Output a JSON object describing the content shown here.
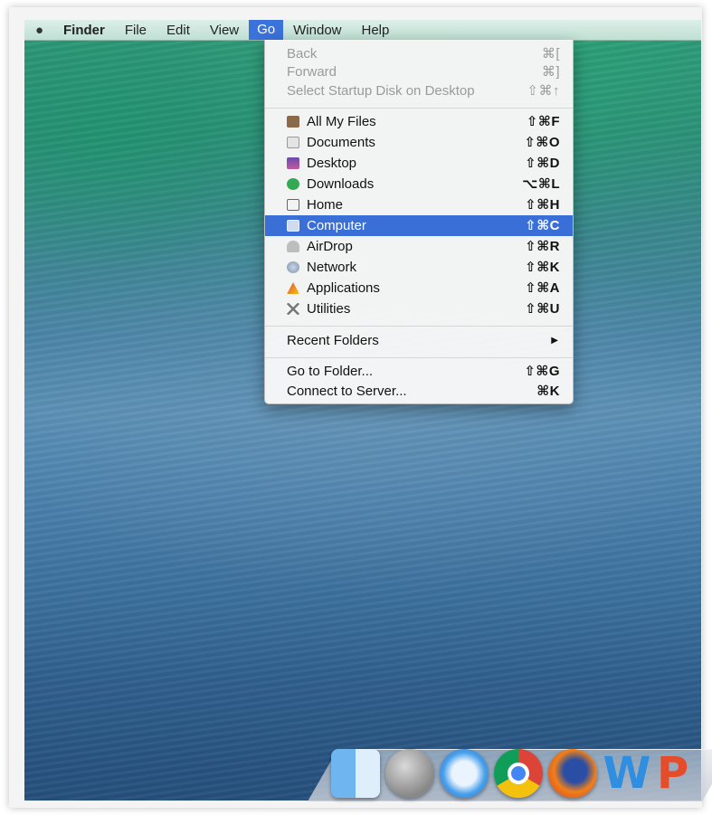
{
  "menubar": {
    "apple_icon": "apple-icon",
    "items": [
      "Finder",
      "File",
      "Edit",
      "View",
      "Go",
      "Window",
      "Help"
    ],
    "active_item": "Go"
  },
  "go_menu": {
    "top_items": [
      {
        "label": "Back",
        "shortcut": "⌘[",
        "enabled": false
      },
      {
        "label": "Forward",
        "shortcut": "⌘]",
        "enabled": false
      },
      {
        "label": "Select Startup Disk on Desktop",
        "shortcut": "⇧⌘↑",
        "enabled": false
      }
    ],
    "places": [
      {
        "label": "All My Files",
        "shortcut": "⇧⌘F",
        "icon": "all-my-files-icon",
        "color": "#8a6a4a"
      },
      {
        "label": "Documents",
        "shortcut": "⇧⌘O",
        "icon": "documents-icon",
        "color": "#c9c9c9"
      },
      {
        "label": "Desktop",
        "shortcut": "⇧⌘D",
        "icon": "desktop-icon",
        "color": "#7a5ab0"
      },
      {
        "label": "Downloads",
        "shortcut": "⌥⌘L",
        "icon": "downloads-icon",
        "color": "#34a853"
      },
      {
        "label": "Home",
        "shortcut": "⇧⌘H",
        "icon": "home-icon",
        "color": "#8a8a8a"
      },
      {
        "label": "Computer",
        "shortcut": "⇧⌘C",
        "icon": "computer-icon",
        "color": "#9fb8d8",
        "highlighted": true
      },
      {
        "label": "AirDrop",
        "shortcut": "⇧⌘R",
        "icon": "airdrop-icon",
        "color": "#9a9a9a"
      },
      {
        "label": "Network",
        "shortcut": "⇧⌘K",
        "icon": "network-icon",
        "color": "#8aa0b8"
      },
      {
        "label": "Applications",
        "shortcut": "⇧⌘A",
        "icon": "applications-icon",
        "color": "#e0a020"
      },
      {
        "label": "Utilities",
        "shortcut": "⇧⌘U",
        "icon": "utilities-icon",
        "color": "#9a9a9a"
      }
    ],
    "recent_folders": {
      "label": "Recent Folders",
      "submenu_arrow": "▶"
    },
    "bottom_items": [
      {
        "label": "Go to Folder...",
        "shortcut": "⇧⌘G"
      },
      {
        "label": "Connect to Server...",
        "shortcut": "⌘K"
      }
    ]
  },
  "dock": {
    "icons": [
      "finder-icon",
      "launchpad-icon",
      "safari-icon",
      "chrome-icon",
      "firefox-icon",
      "word-icon",
      "powerpoint-icon"
    ],
    "word_glyph": "W",
    "powerpoint_glyph": "P"
  },
  "colors": {
    "highlight": "#3a6fd8",
    "menubar": "#cfe9df"
  }
}
